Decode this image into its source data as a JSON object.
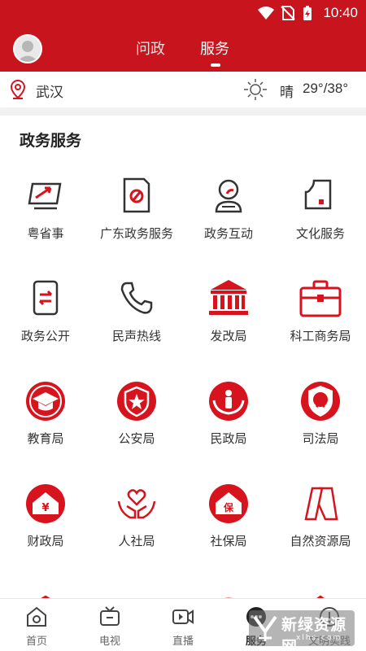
{
  "status_bar": {
    "time": "10:40"
  },
  "header": {
    "tabs": [
      {
        "label": "问政",
        "active": false
      },
      {
        "label": "服务",
        "active": true
      }
    ]
  },
  "location_bar": {
    "city": "武汉",
    "weather": {
      "condition": "晴",
      "temperature": "29°/38°"
    }
  },
  "section": {
    "title": "政务服务"
  },
  "services": [
    {
      "label": "粤省事",
      "icon": "screen-arrow-icon"
    },
    {
      "label": "广东政务服务",
      "icon": "party-document-icon"
    },
    {
      "label": "政务互动",
      "icon": "user-interaction-icon"
    },
    {
      "label": "文化服务",
      "icon": "culture-icon"
    },
    {
      "label": "政务公开",
      "icon": "phone-transfer-icon"
    },
    {
      "label": "民声热线",
      "icon": "telephone-icon"
    },
    {
      "label": "发改局",
      "icon": "building-columns-icon"
    },
    {
      "label": "科工商务局",
      "icon": "briefcase-icon"
    },
    {
      "label": "教育局",
      "icon": "graduation-cap-icon"
    },
    {
      "label": "公安局",
      "icon": "police-star-icon"
    },
    {
      "label": "民政局",
      "icon": "civil-affairs-icon"
    },
    {
      "label": "司法局",
      "icon": "justice-shield-icon"
    },
    {
      "label": "财政局",
      "icon": "finance-yuan-icon"
    },
    {
      "label": "人社局",
      "icon": "hands-heart-icon"
    },
    {
      "label": "社保局",
      "icon": "social-security-icon"
    },
    {
      "label": "自然资源局",
      "icon": "natural-resources-icon"
    }
  ],
  "bottom_nav": [
    {
      "label": "首页",
      "icon": "home-camera-icon",
      "active": false
    },
    {
      "label": "电视",
      "icon": "tv-icon",
      "active": false
    },
    {
      "label": "直播",
      "icon": "video-icon",
      "active": false
    },
    {
      "label": "",
      "icon": "blank-icon",
      "active": false
    },
    {
      "label": "服务",
      "icon": "service-dots-icon",
      "active": true
    },
    {
      "label": "文明实践",
      "icon": "practice-icon",
      "active": false
    }
  ],
  "watermark": {
    "text": "新绿资源网",
    "sub": "xlhs.com"
  },
  "colors": {
    "brand_red": "#c8141c",
    "icon_red": "#d7141e",
    "text": "#333333"
  }
}
